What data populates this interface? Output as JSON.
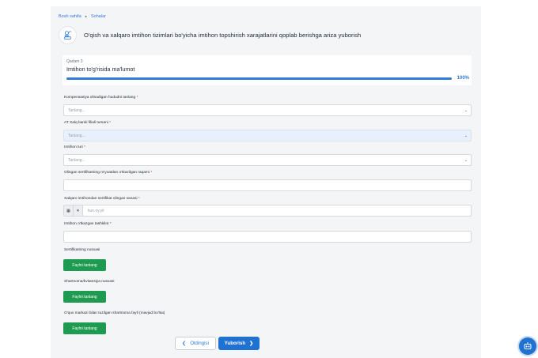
{
  "breadcrumb": {
    "home": "Bosh sahifa",
    "current": "Sohalar"
  },
  "page_title": "O'qish va xalqaro imtihon tizimlari bo'yicha imtihon topshirish xarajatlarini qoplab berishga ariza yuborish",
  "stepper": {
    "step_number": "Qadam 3",
    "step_title": "Imtihon to'g'risida ma'lumot",
    "progress": 100,
    "progress_label": "100%"
  },
  "form": {
    "region": {
      "label": "Kompensasiya olinadigan hududni tanlang",
      "required": "*",
      "placeholder": "Tanlang..."
    },
    "bank_branch": {
      "label": "AT Xalq banki filiali tumani",
      "required": "*",
      "placeholder": "Tanlang..."
    },
    "exam_type": {
      "label": "Imtihon turi",
      "required": "*",
      "placeholder": "Tanlang..."
    },
    "certificate_number": {
      "label": "Olingan sertifikatning ro'yxatdan o'tkazilgan raqami",
      "required": "*"
    },
    "certificate_date": {
      "label": "Xalqaro imtihondan sertifikat olingan sanasi",
      "required": "*",
      "placeholder": "kun.oy.yil"
    },
    "organizer": {
      "label": "Imtihon o'tkazgan tashkilot",
      "required": "*"
    },
    "certificate_copy": {
      "label": "Sertifikatning nusxasi",
      "button": "Faylni tanlang"
    },
    "contract_copy": {
      "label": "Shartnoma/kvitansiya nusxasi",
      "button": "Faylni tanlang"
    },
    "training_contract": {
      "label": "O'quv markazi bilan tuzilgan shartnoma fayli (mavjud bo'lsa)",
      "button": "Faylni tanlang"
    }
  },
  "nav": {
    "prev_label": "Oldingisi",
    "next_label": "Yuborish"
  },
  "colors": {
    "primary": "#1f72d1",
    "success": "#1e9b51",
    "required": "#dc2626",
    "background": "#f4f5f7"
  }
}
